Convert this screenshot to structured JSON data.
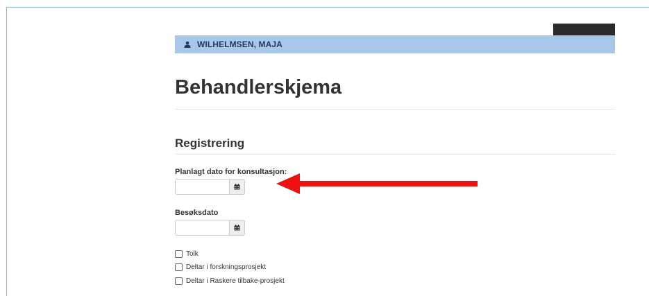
{
  "patient": {
    "name": "WILHELMSEN, MAJA",
    "icon": "user-icon"
  },
  "page": {
    "title": "Behandlerskjema"
  },
  "section": {
    "title": "Registrering"
  },
  "fields": {
    "planned_date": {
      "label": "Planlagt dato for konsultasjon:",
      "value": "",
      "icon": "calendar-icon"
    },
    "visit_date": {
      "label": "Besøksdato",
      "value": "",
      "icon": "calendar-icon"
    }
  },
  "checkboxes": [
    {
      "label": "Tolk",
      "checked": false
    },
    {
      "label": "Deltar i forskningsprosjekt",
      "checked": false
    },
    {
      "label": "Deltar i Raskere tilbake-prosjekt",
      "checked": false
    }
  ],
  "annotation": {
    "arrow_color": "#ee1111",
    "arrow_points_to": "planned-date-input"
  },
  "colors": {
    "patient_bar": "#a9c7e8",
    "dark_tab": "#2b2b2b"
  }
}
